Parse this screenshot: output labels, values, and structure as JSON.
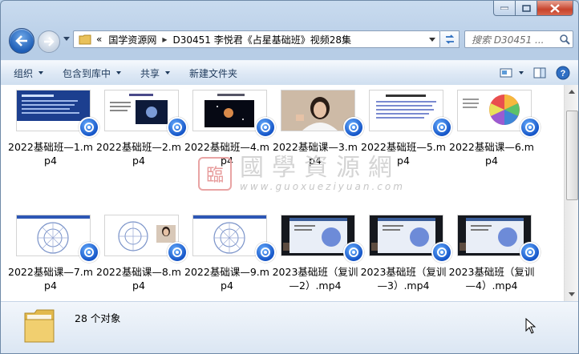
{
  "address": {
    "overflow": "«",
    "crumbs": [
      "国学资源网",
      "D30451 李悦君《占星基础班》视频28集"
    ]
  },
  "search": {
    "placeholder": "搜索 D30451 ..."
  },
  "toolbar": {
    "organize": "组织",
    "include_library": "包含到库中",
    "share": "共享",
    "new_folder": "新建文件夹"
  },
  "files": [
    {
      "name": "2022基础班—1.mp4",
      "thumb": "slide-blue"
    },
    {
      "name": "2022基础班—2.mp4",
      "thumb": "slide-space"
    },
    {
      "name": "2022基础班—4.mp4",
      "thumb": "slide-planet"
    },
    {
      "name": "2022基础课—3.mp4",
      "thumb": "webcam"
    },
    {
      "name": "2022基础班—5.mp4",
      "thumb": "slide-text"
    },
    {
      "name": "2022基础课—6.mp4",
      "thumb": "slide-wheel-color"
    },
    {
      "name": "2022基础课—7.mp4",
      "thumb": "slide-chart"
    },
    {
      "name": "2022基础课—8.mp4",
      "thumb": "slide-chart-cam"
    },
    {
      "name": "2022基础课—9.mp4",
      "thumb": "slide-chart"
    },
    {
      "name": "2023基础班（复训—2）.mp4",
      "thumb": "screen-dark"
    },
    {
      "name": "2023基础班（复训—3）.mp4",
      "thumb": "screen-dark"
    },
    {
      "name": "2023基础班（复训—4）.mp4",
      "thumb": "screen-dark"
    }
  ],
  "watermark": {
    "seal": "臨",
    "title": "國學資源網",
    "url": "www.guoxueziyuan.com"
  },
  "status": {
    "count": "28 个对象"
  }
}
